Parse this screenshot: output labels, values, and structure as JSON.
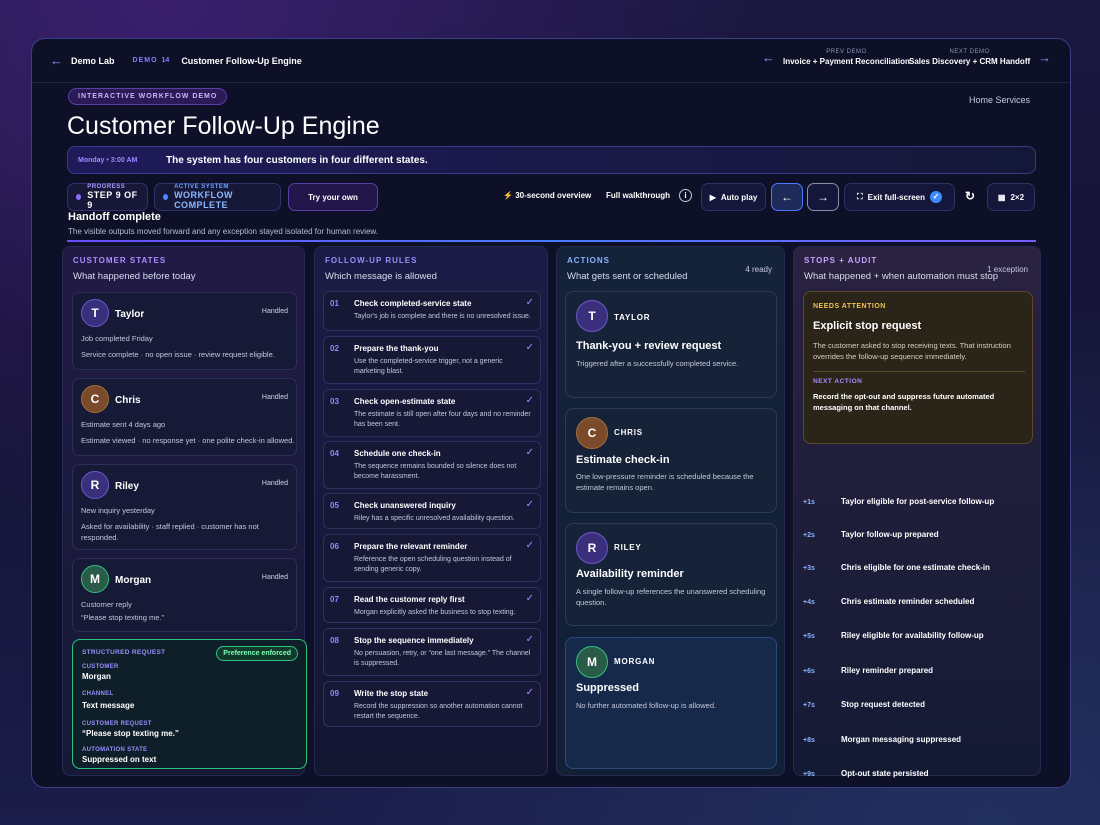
{
  "topbar": {
    "back_label": "Demo Lab",
    "demo_tag": "DEMO",
    "demo_number": "14",
    "demo_title": "Customer Follow-Up Engine",
    "prev_caption": "PREV DEMO",
    "prev_name": "Invoice + Payment Reconciliation",
    "next_caption": "NEXT DEMO",
    "next_name": "Sales Discovery + CRM Handoff"
  },
  "header": {
    "pill": "INTERACTIVE WORKFLOW DEMO",
    "title": "Customer Follow-Up Engine",
    "category": "Home Services"
  },
  "status": {
    "day": "Monday  •  3:00 AM",
    "message": "The system has four customers in four different states."
  },
  "controls": {
    "progress_label": "PROGRESS",
    "progress_value": "STEP 9 OF 9",
    "system_label": "ACTIVE SYSTEM",
    "system_value": "WORKFLOW COMPLETE",
    "try_label": "Try your own",
    "overview_label": "30-second overview",
    "walkthrough_label": "Full walkthrough",
    "autoplay_label": "Auto play",
    "exit_label": "Exit full-screen",
    "grid_label": "2×2"
  },
  "handoff": {
    "title": "Handoff complete",
    "subtitle": "The visible outputs moved forward and any exception stayed isolated for human review."
  },
  "columns": {
    "states": {
      "title": "CUSTOMER STATES",
      "subtitle": "What happened before today",
      "customers": [
        {
          "name": "Taylor",
          "status": "Handled",
          "line1": "Job completed Friday",
          "line2": "Service complete · no open issue · review request eligible."
        },
        {
          "name": "Chris",
          "status": "Handled",
          "line1": "Estimate sent 4 days ago",
          "line2": "Estimate viewed · no response yet · one polite check-in allowed."
        },
        {
          "name": "Riley",
          "status": "Handled",
          "line1": "New inquiry yesterday",
          "line2": "Asked for availability · staff replied · customer has not responded."
        },
        {
          "name": "Morgan",
          "status": "Handled",
          "line1": "Customer reply",
          "line2": "“Please stop texting me.”"
        }
      ],
      "request": {
        "title": "STRUCTURED REQUEST",
        "badge": "Preference enforced",
        "customer_label": "CUSTOMER",
        "customer": "Morgan",
        "channel_label": "CHANNEL",
        "channel": "Text message",
        "req_label": "CUSTOMER REQUEST",
        "req": "“Please stop texting me.”",
        "state_label": "AUTOMATION STATE",
        "state": "Suppressed on text"
      }
    },
    "rules": {
      "title": "FOLLOW-UP RULES",
      "subtitle": "Which message is allowed",
      "items": [
        {
          "num": "01",
          "title": "Check completed-service state",
          "desc": "Taylor's job is complete and there is no unresolved issue."
        },
        {
          "num": "02",
          "title": "Prepare the thank-you",
          "desc": "Use the completed-service trigger, not a generic marketing blast."
        },
        {
          "num": "03",
          "title": "Check open-estimate state",
          "desc": "The estimate is still open after four days and no reminder has been sent."
        },
        {
          "num": "04",
          "title": "Schedule one check-in",
          "desc": "The sequence remains bounded so silence does not become harassment."
        },
        {
          "num": "05",
          "title": "Check unanswered inquiry",
          "desc": "Riley has a specific unresolved availability question."
        },
        {
          "num": "06",
          "title": "Prepare the relevant reminder",
          "desc": "Reference the open scheduling question instead of sending generic copy."
        },
        {
          "num": "07",
          "title": "Read the customer reply first",
          "desc": "Morgan explicitly asked the business to stop texting."
        },
        {
          "num": "08",
          "title": "Stop the sequence immediately",
          "desc": "No persuasion, retry, or “one last message.” The channel is suppressed."
        },
        {
          "num": "09",
          "title": "Write the stop state",
          "desc": "Record the suppression so another automation cannot restart the sequence."
        }
      ]
    },
    "actions": {
      "title": "ACTIONS",
      "subtitle": "What gets sent or scheduled",
      "count": "4 ready",
      "items": [
        {
          "tag": "TAYLOR",
          "title": "Thank-you + review request",
          "desc": "Triggered after a successfully completed service."
        },
        {
          "tag": "CHRIS",
          "title": "Estimate check-in",
          "desc": "One low-pressure reminder is scheduled because the estimate remains open."
        },
        {
          "tag": "RILEY",
          "title": "Availability reminder",
          "desc": "A single follow-up references the unanswered scheduling question."
        },
        {
          "tag": "MORGAN",
          "title": "Suppressed",
          "desc": "No further automated follow-up is allowed."
        }
      ]
    },
    "audit": {
      "title": "STOPS + AUDIT",
      "subtitle": "What happened + when automation must stop",
      "count": "1 exception",
      "attention": {
        "label": "NEEDS ATTENTION",
        "title": "Explicit stop request",
        "desc": "The customer asked to stop receiving texts. That instruction overrides the follow-up sequence immediately.",
        "next_label": "NEXT ACTION",
        "next": "Record the opt-out and suppress future automated messaging on that channel."
      },
      "timeline": [
        {
          "t": "+1s",
          "text": "Taylor eligible for post-service follow-up"
        },
        {
          "t": "+2s",
          "text": "Taylor follow-up prepared"
        },
        {
          "t": "+3s",
          "text": "Chris eligible for one estimate check-in"
        },
        {
          "t": "+4s",
          "text": "Chris estimate reminder scheduled"
        },
        {
          "t": "+5s",
          "text": "Riley eligible for availability follow-up"
        },
        {
          "t": "+6s",
          "text": "Riley reminder prepared"
        },
        {
          "t": "+7s",
          "text": "Stop request detected"
        },
        {
          "t": "+8s",
          "text": "Morgan messaging suppressed"
        },
        {
          "t": "+9s",
          "text": "Opt-out state persisted"
        }
      ]
    }
  },
  "colors": {
    "accent": "#7a5cff",
    "green": "#2ec27e",
    "gold": "#f2c14e"
  }
}
